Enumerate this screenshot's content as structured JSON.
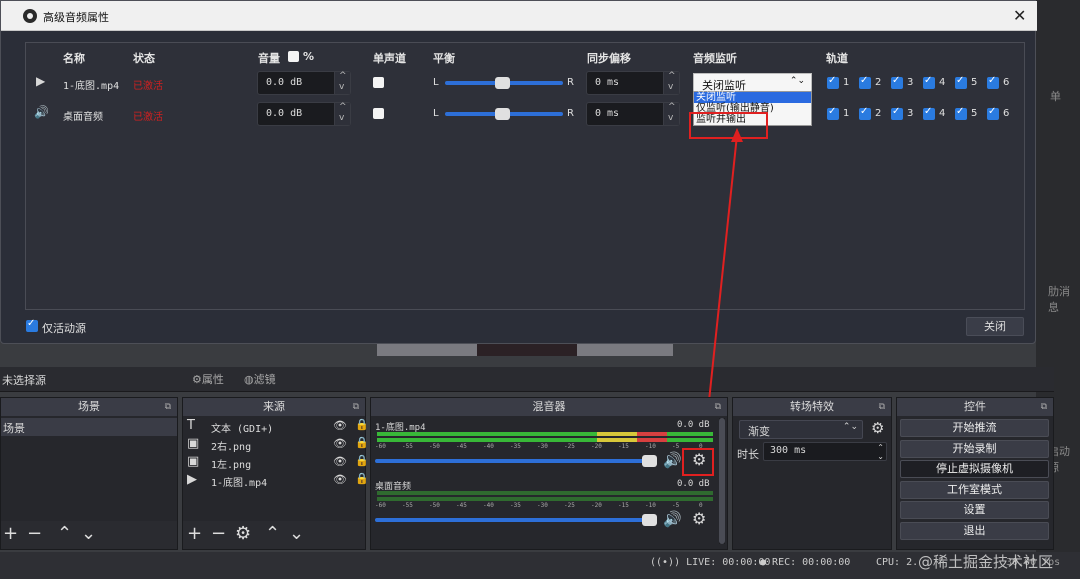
{
  "dialog": {
    "title": "高级音频属性",
    "close": "✕",
    "headers": {
      "name": "名称",
      "status": "状态",
      "volume": "音量",
      "percent": "%",
      "mono": "单声道",
      "balance": "平衡",
      "sync": "同步偏移",
      "monitor": "音频监听",
      "tracks": "轨道"
    },
    "rows": [
      {
        "name": "1-底图.mp4",
        "status": "已激活",
        "volume": "0.0 dB",
        "L": "L",
        "R": "R",
        "sync": "0 ms"
      },
      {
        "name": "桌面音频",
        "status": "已激活",
        "volume": "0.0 dB",
        "L": "L",
        "R": "R",
        "sync": "0 ms"
      }
    ],
    "track_labels": [
      "1",
      "2",
      "3",
      "4",
      "5",
      "6"
    ],
    "monitor_value": "关闭监听",
    "monitor_options": [
      "关闭监听",
      "仅监听(输出静音)",
      "监听并输出"
    ],
    "active_only": "仅活动源",
    "close_button": "关闭"
  },
  "bg": {
    "texts": [
      "单",
      "肋消息",
      "启动源"
    ]
  },
  "toolbar": {
    "no_source": "未选择源",
    "props": "属性",
    "filters": "滤镜"
  },
  "docks": {
    "scenes": "场景",
    "sources": "来源",
    "mixer": "混音器",
    "transitions": "转场特效",
    "controls": "控件"
  },
  "scenes": [
    "场景"
  ],
  "sources": [
    {
      "name": "文本 (GDI+)",
      "icon": "T"
    },
    {
      "name": "2右.png",
      "icon": "▣"
    },
    {
      "name": "1左.png",
      "icon": "▣"
    },
    {
      "name": "1-底图.mp4",
      "icon": "▶"
    }
  ],
  "mixer": {
    "channels": [
      {
        "name": "1-底图.mp4",
        "db": "0.0 dB"
      },
      {
        "name": "桌面音频",
        "db": "0.0 dB"
      }
    ],
    "ticks": [
      "-60",
      "-55",
      "-50",
      "-45",
      "-40",
      "-35",
      "-30",
      "-25",
      "-20",
      "-15",
      "-10",
      "-5",
      "0"
    ]
  },
  "transitions": {
    "type": "渐变",
    "duration_label": "时长",
    "duration": "300 ms"
  },
  "controls": [
    "开始推流",
    "开始录制",
    "停止虚拟摄像机",
    "工作室模式",
    "设置",
    "退出"
  ],
  "status": {
    "live": "LIVE: 00:00:00",
    "rec": "REC: 00:00:00",
    "cpu": "CPU: 2.",
    "fps": "30.00 fps"
  },
  "watermark": "@稀土掘金技术社区",
  "colors": {
    "accent": "#2a6ae0",
    "active_status": "#d12020",
    "highlight": "#e02020",
    "meter_green": "#38b838"
  }
}
